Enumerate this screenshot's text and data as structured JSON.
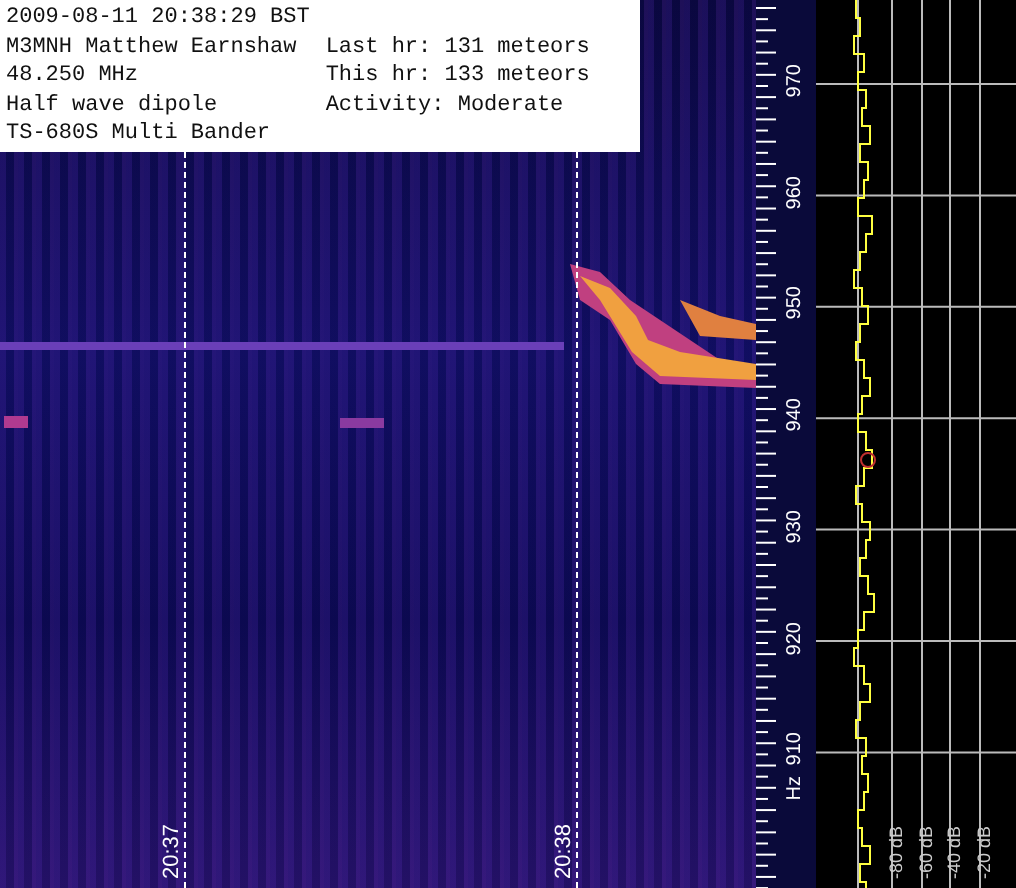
{
  "info": {
    "timestamp": "2009-08-11 20:38:29 BST",
    "station": "M3MNH Matthew Earnshaw",
    "frequency": "48.250 MHz",
    "antenna": "Half wave dipole",
    "receiver": "TS-680S Multi Bander",
    "last_hour": "Last hr: 131 meteors",
    "this_hour": "This hr: 133 meteors",
    "activity": "Activity: Moderate"
  },
  "time_markers": [
    {
      "label": "20:37"
    },
    {
      "label": "20:38"
    }
  ],
  "frequency_scale": {
    "ticks": [
      "970",
      "960",
      "950",
      "940",
      "930",
      "920",
      "910"
    ],
    "unit": "Hz"
  },
  "power_scale": {
    "ticks": [
      "-80 dB",
      "-60 dB",
      "-40 dB",
      "-20 dB"
    ]
  }
}
